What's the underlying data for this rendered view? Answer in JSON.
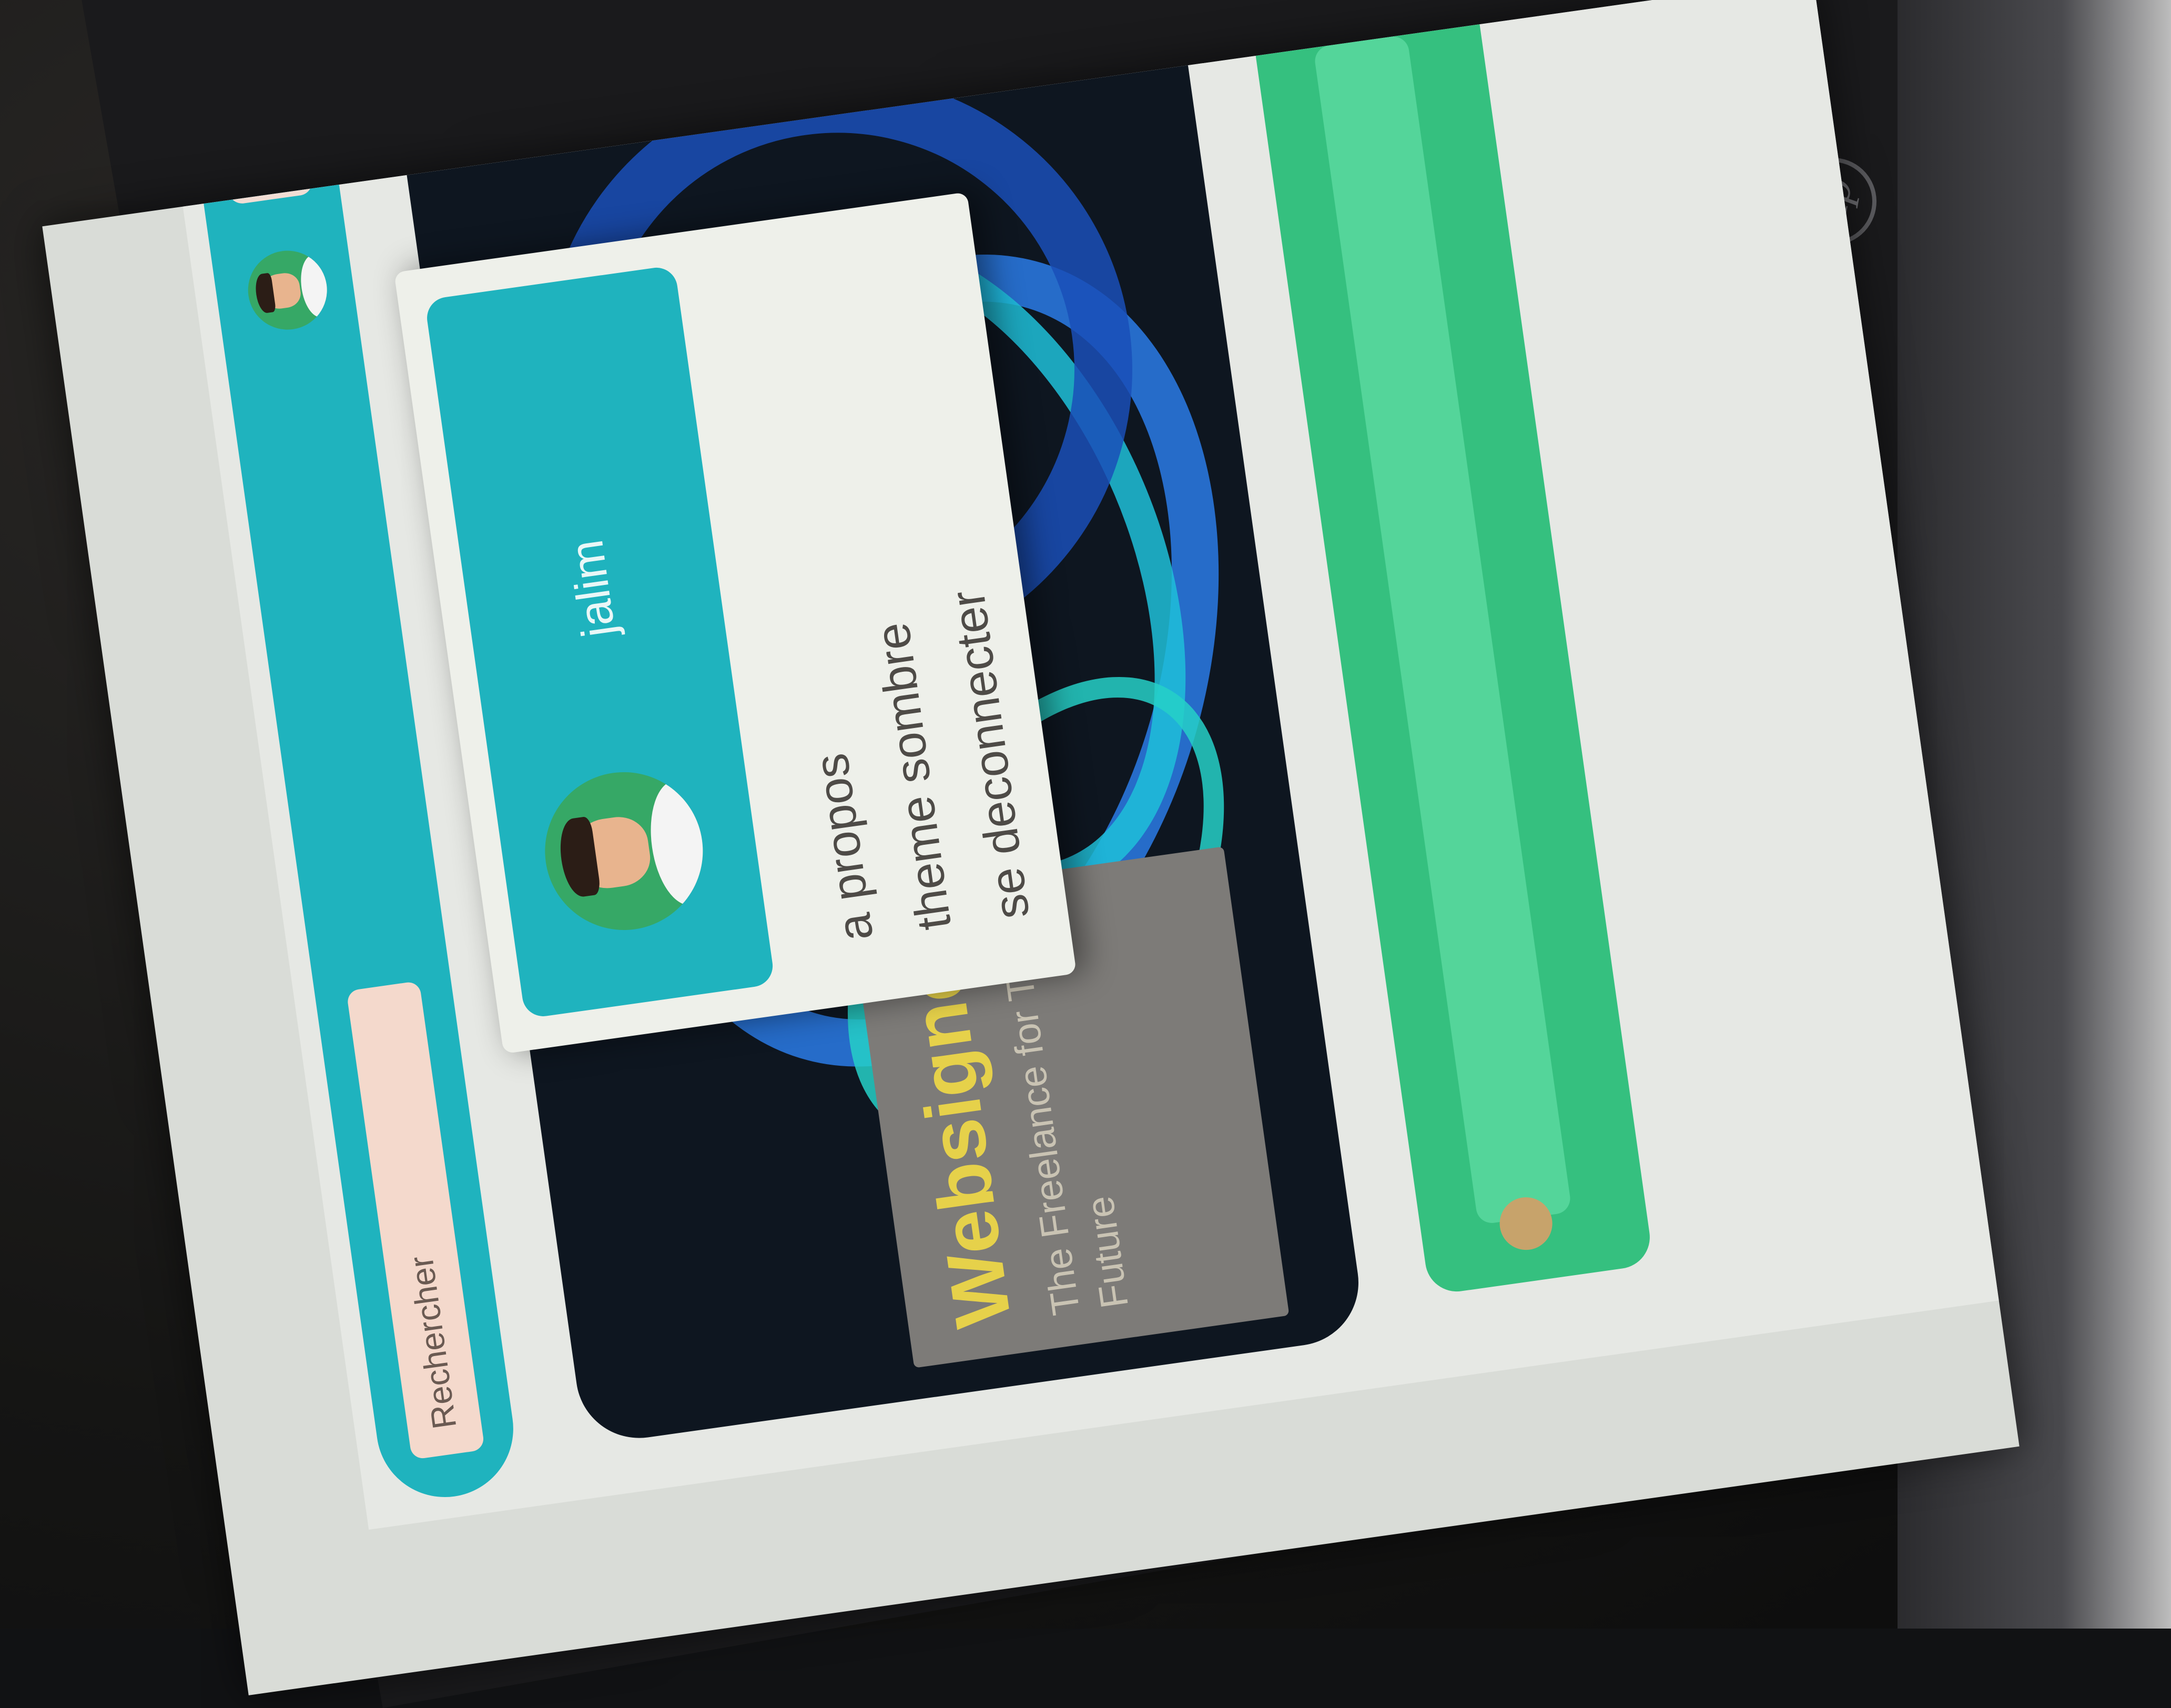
{
  "header": {
    "search_placeholder": "Rechercher"
  },
  "hero": {
    "brand_title": "Websignerr",
    "brand_subtitle": "The Freelance for The Future"
  },
  "dropdown": {
    "user_name": "jalim",
    "items": [
      {
        "label": "a propos"
      },
      {
        "label": "theme sombre"
      },
      {
        "label": "se deconnecter"
      }
    ]
  },
  "device": {
    "brand_logo": "hp"
  },
  "icons": {
    "menu": "hamburger-icon",
    "avatar": "user-avatar-icon"
  },
  "colors": {
    "topbar": "#1fb3be",
    "menu_button": "#f2ddd4",
    "profile_card": "#1fb3be",
    "footer": "#35c07f",
    "brand_title": "#e6d14a"
  }
}
